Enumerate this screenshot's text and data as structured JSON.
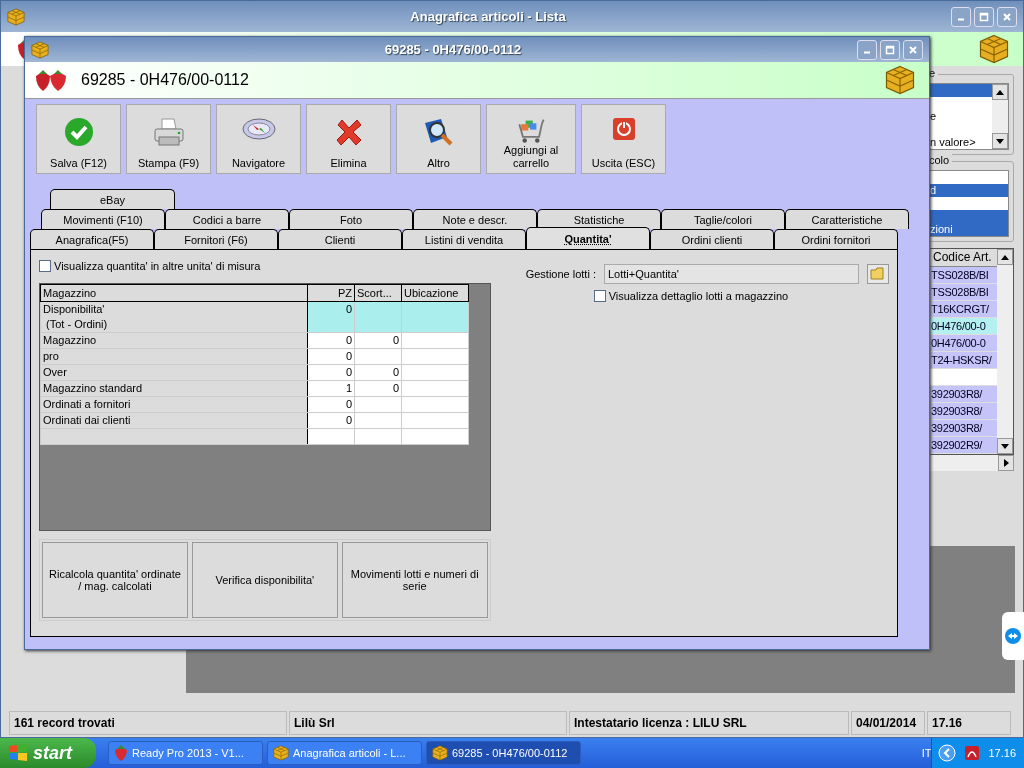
{
  "back_window": {
    "title": "Anagrafica articoli  - Lista",
    "filter_group": {
      "label": "e",
      "items": [
        {
          "selected": true
        },
        {
          "selected": false
        },
        {
          "text": "e",
          "selected": false
        },
        {
          "selected": false
        },
        {
          "text": "n valore>",
          "selected": false
        }
      ]
    },
    "calc_group": {
      "label": "colo",
      "items": [
        {
          "selected": false
        },
        {
          "text": "d",
          "selected": true
        },
        {
          "selected": false
        },
        {
          "selected": true
        },
        {
          "text": "zioni",
          "selected": true
        }
      ]
    },
    "grid": {
      "column": "Codice Art.",
      "rows": [
        {
          "code": "TSS028B/BI",
          "kind": "marked"
        },
        {
          "code": "TSS028B/BI",
          "kind": "marked"
        },
        {
          "code": "T16KCRGT/",
          "kind": "marked"
        },
        {
          "code": "0H476/00-0",
          "kind": "current"
        },
        {
          "code": "0H476/00-0",
          "kind": "marked"
        },
        {
          "code": "T24-HSKSR/",
          "kind": "marked"
        },
        {
          "kind": "plain"
        },
        {
          "code": "392903R8/",
          "kind": "marked"
        },
        {
          "code": "392903R8/",
          "kind": "marked"
        },
        {
          "code": "392903R8/",
          "kind": "marked"
        },
        {
          "code": "392902R9/",
          "kind": "marked"
        }
      ]
    },
    "status_bar": [
      "161 record trovati",
      "Lilù Srl",
      "Intestatario licenza : LILU SRL",
      "04/01/2014",
      "17.16"
    ]
  },
  "front_window": {
    "title": "69285 - 0H476/00-0112",
    "header": "69285 - 0H476/00-0112",
    "toolbar": [
      {
        "label": "Salva (F12)"
      },
      {
        "label": "Stampa (F9)"
      },
      {
        "label": "Navigatore"
      },
      {
        "label": "Elimina"
      },
      {
        "label": "Altro"
      },
      {
        "label": "Aggiungi al carrello"
      },
      {
        "label": "Uscita (ESC)"
      }
    ],
    "tab_rows": [
      [
        {
          "label": "eBay",
          "selected": false
        }
      ],
      [
        {
          "label": "Movimenti (F10)",
          "selected": false
        },
        {
          "label": "Codici a barre",
          "selected": false
        },
        {
          "label": "Foto",
          "selected": false
        },
        {
          "label": "Note e descr.",
          "selected": false
        },
        {
          "label": "Statistiche",
          "selected": false
        },
        {
          "label": "Taglie/colori",
          "selected": false
        },
        {
          "label": "Caratteristiche",
          "selected": false
        }
      ],
      [
        {
          "label": "Anagrafica(F5)",
          "selected": false
        },
        {
          "label": "Fornitori (F6)",
          "selected": false
        },
        {
          "label": "Clienti",
          "selected": false
        },
        {
          "label": "Listini di vendita",
          "selected": false
        },
        {
          "label": "Quantita'",
          "selected": true
        },
        {
          "label": "Ordini clienti",
          "selected": false
        },
        {
          "label": "Ordini fornitori",
          "selected": false
        }
      ]
    ],
    "other_units": {
      "label": "Visualizza quantita' in altre unita' di misura",
      "checked": false
    },
    "stock_table": {
      "columns": [
        "Magazzino",
        "PZ",
        "Scort...",
        "Ubicazione"
      ],
      "rows": [
        {
          "name": "Disponibilita'\n (Tot - Ordini)",
          "pz": "0",
          "kind": "summary"
        },
        {
          "name": "Magazzino",
          "pz": "0",
          "scorta": "0",
          "kind": "plain"
        },
        {
          "name": "pro",
          "pz": "0",
          "kind": "plain"
        },
        {
          "name": "Over",
          "pz": "0",
          "scorta": "0",
          "kind": "plain"
        },
        {
          "name": "Magazzino standard",
          "pz": "1",
          "scorta": "0",
          "kind": "plain"
        },
        {
          "name": "Ordinati a fornitori",
          "pz": "0",
          "kind": "plain"
        },
        {
          "name": "Ordinati dai clienti",
          "pz": "0",
          "kind": "plain"
        }
      ]
    },
    "actions": [
      "Ricalcola quantita' ordinate / mag. calcolati",
      "Verifica disponibilita'",
      "Movimenti lotti e numeri di serie"
    ],
    "lots": {
      "label": "Gestione lotti :",
      "value": "Lotti+Quantita'"
    },
    "lot_detail": {
      "label": "Visualizza dettaglio lotti a magazzino",
      "checked": false
    }
  },
  "taskbar": {
    "start": "start",
    "tasks": [
      {
        "label": "Ready Pro 2013 - V1...",
        "selected": false
      },
      {
        "label": "Anagrafica articoli  - L...",
        "selected": false
      },
      {
        "label": "69285 - 0H476/00-0112",
        "selected": true
      }
    ],
    "language": "IT",
    "clock": "17.16"
  }
}
